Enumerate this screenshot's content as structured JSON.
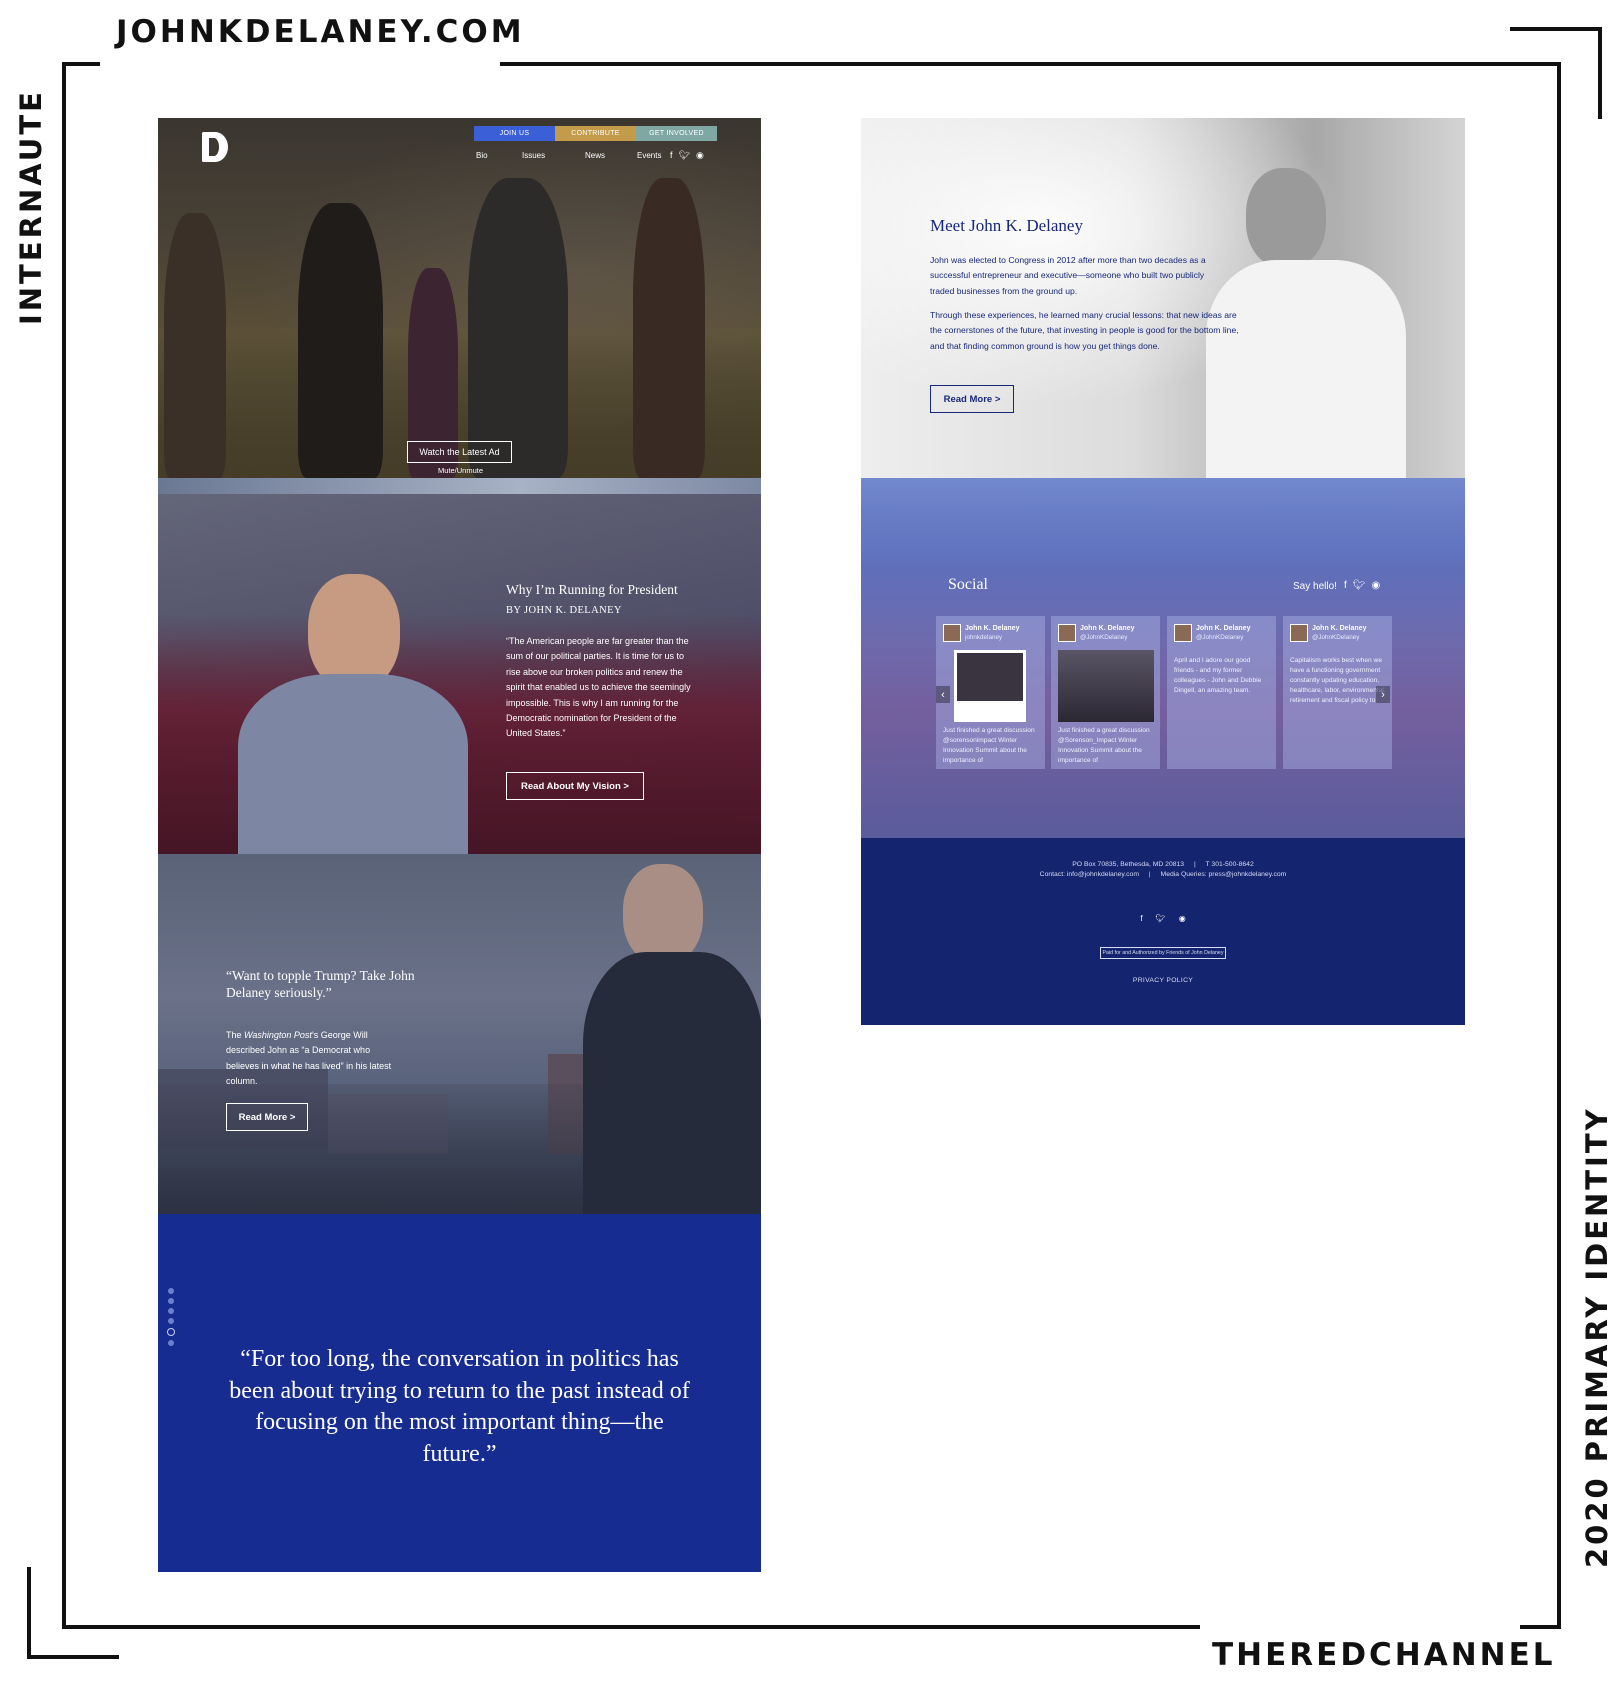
{
  "labels": {
    "site": "JOHNKDELANEY.COM",
    "agency": "THEREDCHANNEL",
    "left": "INTERNAUTE",
    "right": "2020 PRIMARY IDENTITY"
  },
  "hero": {
    "buttons": [
      {
        "label": "JOIN US",
        "color": "#3a5fd6"
      },
      {
        "label": "CONTRIBUTE",
        "color": "#c49b4a"
      },
      {
        "label": "GET INVOLVED",
        "color": "#7fa8a4"
      }
    ],
    "nav": [
      "Bio",
      "Issues",
      "News",
      "Events"
    ],
    "social_icons": [
      "f",
      "t",
      "ig"
    ],
    "watch_label": "Watch the Latest Ad",
    "mute_label": "Mute/Unmute"
  },
  "why": {
    "title": "Why I’m Running for President",
    "byline": "BY JOHN K. DELANEY",
    "quote": "“The American people are far greater than the sum of our political parties. It is time for us to rise above our broken politics and renew the spirit that enabled us to achieve the seemingly impossible. This is why I am running for the Democratic nomination for President of the United States.”",
    "button": "Read About My Vision >"
  },
  "topple": {
    "title": "“Want to topple Trump? Take John Delaney seriously.”",
    "body_pre": "The ",
    "body_em": "Washington Post",
    "body_post": "’s George Will described John as “a Democrat who believes in what he has lived” in his latest column.",
    "button": "Read More >"
  },
  "quote_section": {
    "quote": "“For too long, the conversation in politics has been about trying to return to the past instead of focusing on the most important thing—the future.”",
    "dot_count": 6,
    "active_dot": 4
  },
  "meet": {
    "title": "Meet John K. Delaney",
    "p1": "John was elected to Congress in 2012 after more than two decades as a successful entrepreneur and executive—someone who built two publicly traded businesses from the ground up.",
    "p2": "Through these experiences, he learned many crucial lessons: that new ideas are the cornerstones of the future, that investing in people is good for the bottom line, and that finding common ground is how you get things done.",
    "button": "Read More >"
  },
  "social": {
    "title": "Social",
    "say_hello": "Say hello!",
    "cards": [
      {
        "name": "John K. Delaney",
        "handle": "johnkdelaney",
        "text": "Just finished a great discussion @sorensonimpact Winter Innovation Summit about the importance of",
        "has_photo": true
      },
      {
        "name": "John K. Delaney",
        "handle": "@JohnKDelaney",
        "text": "Just finished a great discussion @Sorenson_Impact Winter Innovation Summit about the importance of",
        "has_photo": true
      },
      {
        "name": "John K. Delaney",
        "handle": "@JohnKDelaney",
        "text": "April and I adore our good friends - and my former colleagues - John and Debbie Dingell, an amazing team.",
        "has_photo": false
      },
      {
        "name": "John K. Delaney",
        "handle": "@JohnKDelaney",
        "text": "Capitalism works best when we have a functioning government constantly updating education, healthcare, labor, environmental, retirement and fiscal policy to",
        "has_photo": false
      }
    ]
  },
  "footer": {
    "address": "PO Box 70835, Bethesda, MD 20813",
    "phone": "T 301-500-8642",
    "contact": "Contact: info@johnkdelaney.com",
    "media": "Media Queries: press@johnkdelaney.com",
    "paid_for": "Paid for and Authorized by Friends of John Delaney",
    "privacy": "PRIVACY POLICY"
  }
}
